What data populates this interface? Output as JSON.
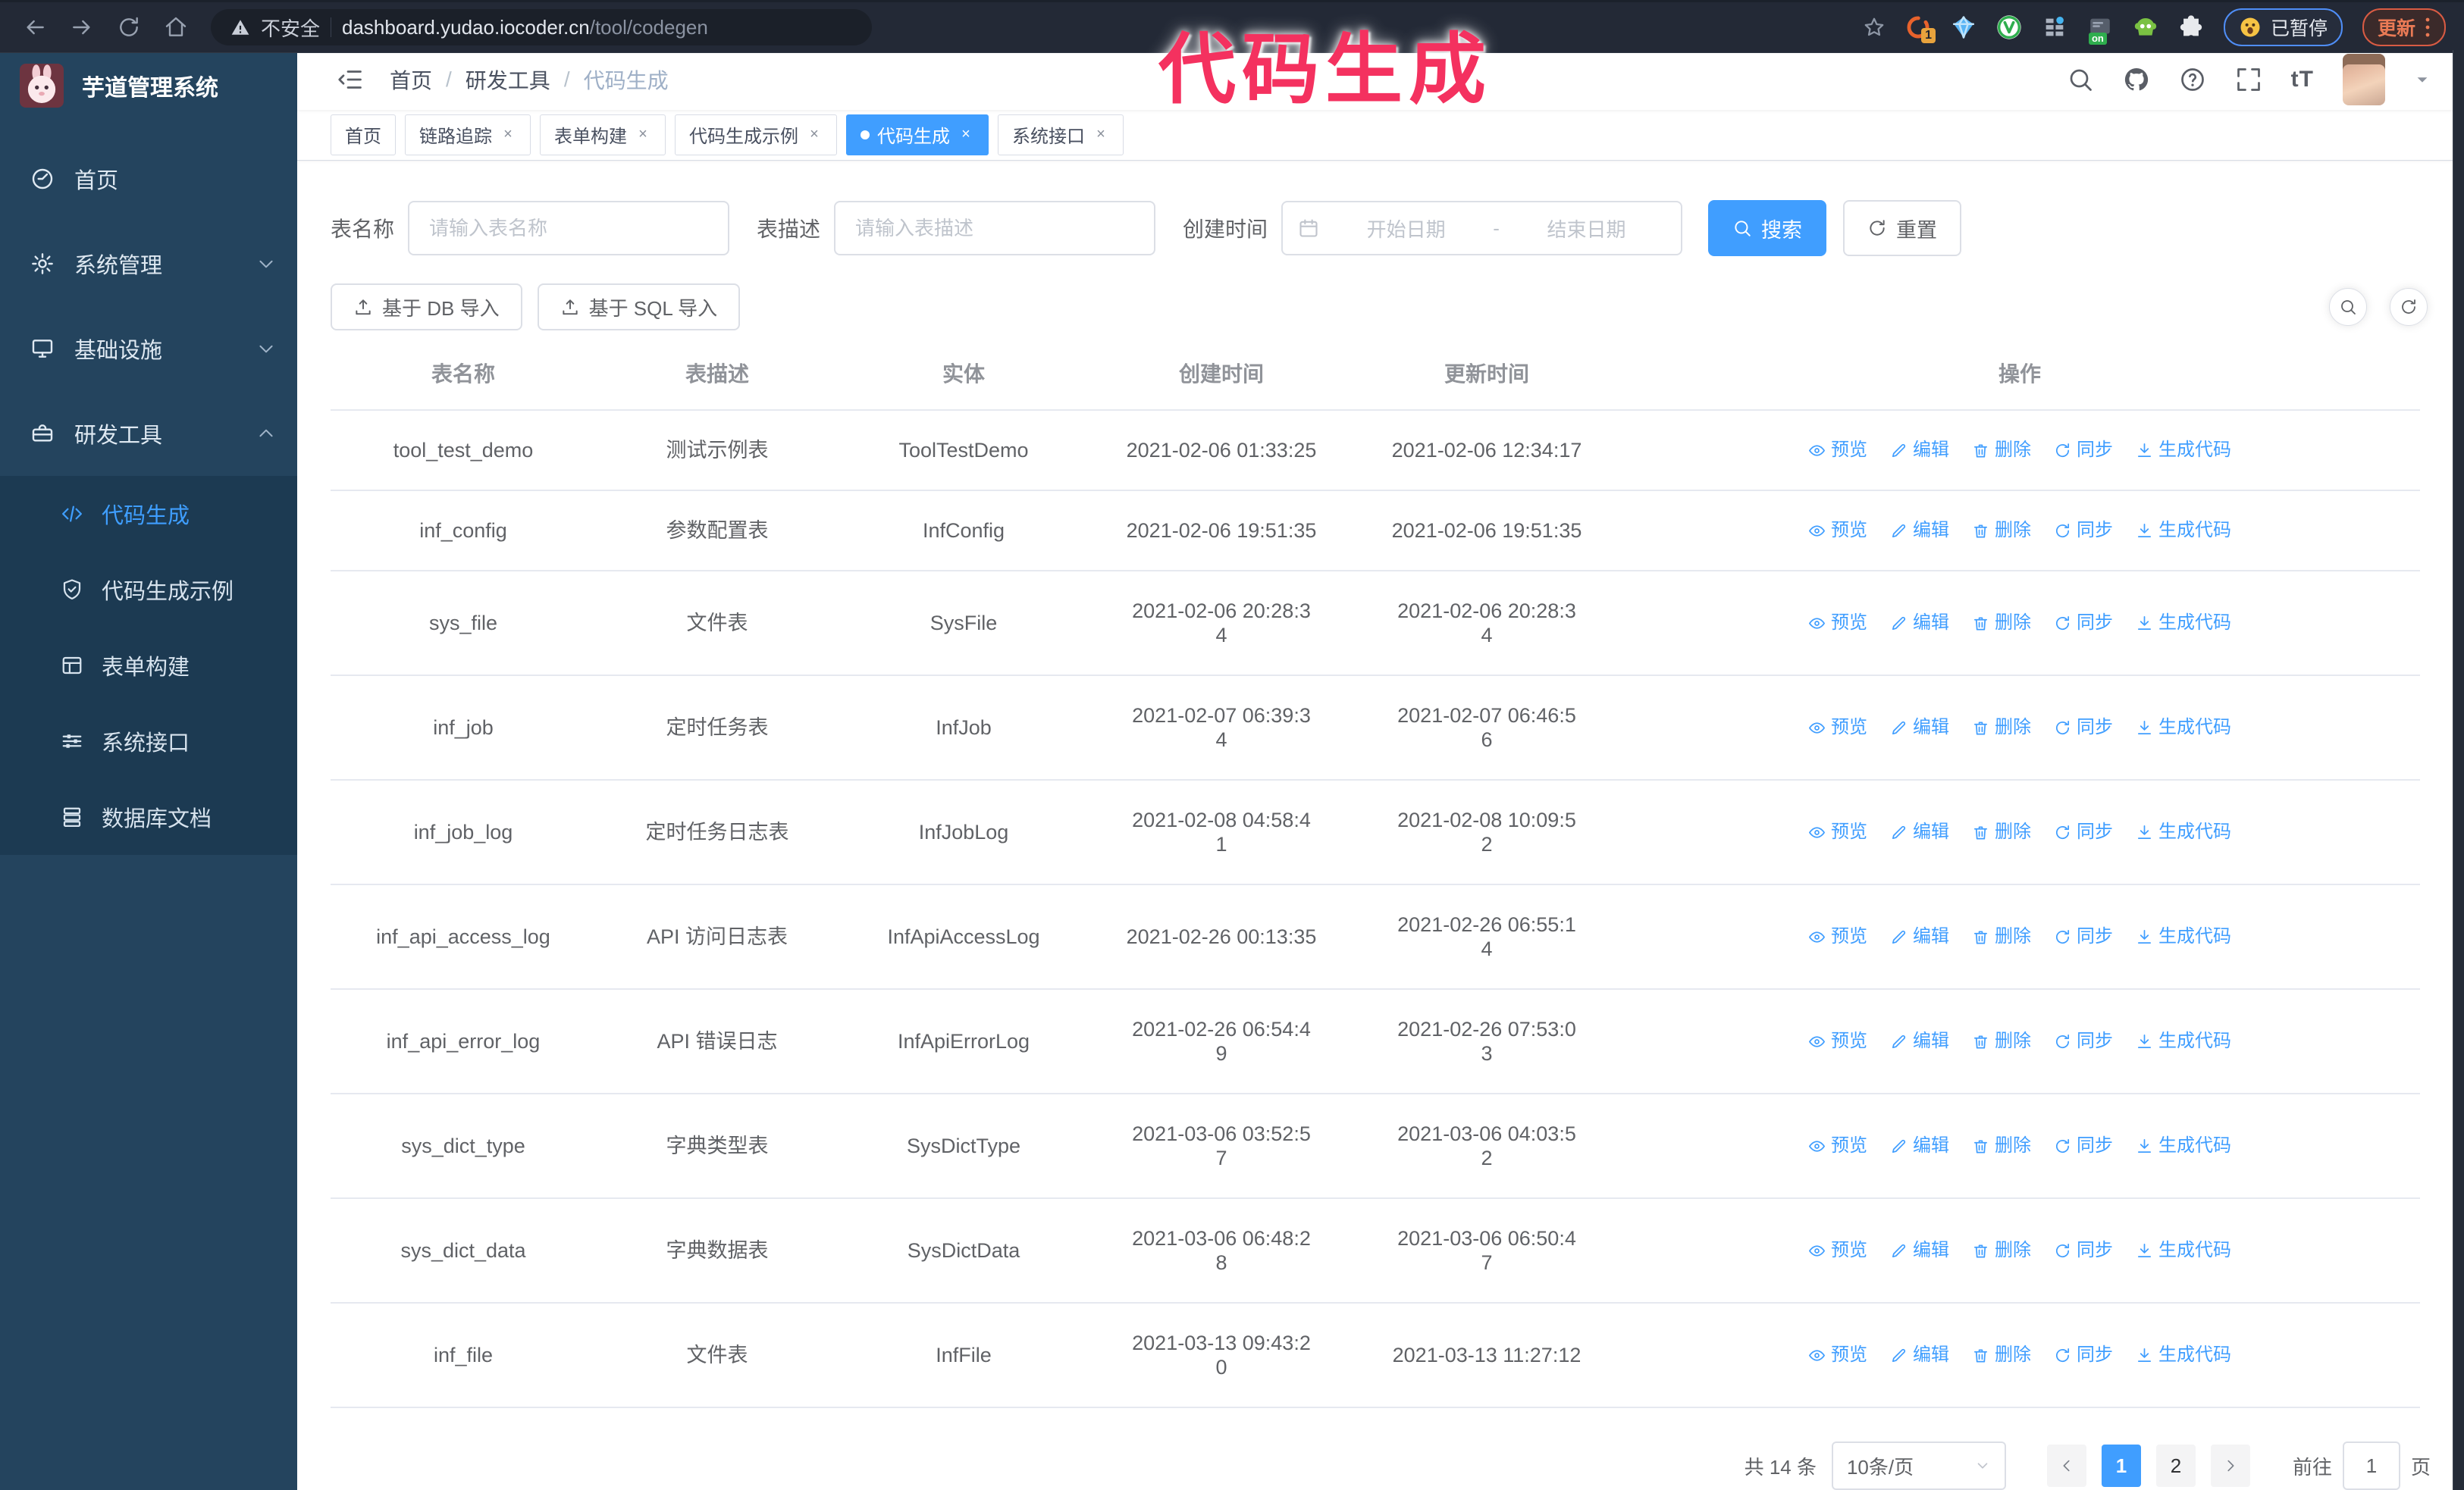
{
  "overlay_title": "代码生成",
  "browser": {
    "security_label": "不安全",
    "url_host": "dashboard.yudao.iocoder.cn",
    "url_path": "/tool/codegen",
    "ext_badge": "1",
    "ext_on_label": "on",
    "paused_label": "已暂停",
    "update_label": "更新"
  },
  "sidebar": {
    "title": "芋道管理系统",
    "items": [
      {
        "label": "首页"
      },
      {
        "label": "系统管理"
      },
      {
        "label": "基础设施"
      },
      {
        "label": "研发工具"
      }
    ],
    "subitems": [
      {
        "label": "代码生成",
        "active": true
      },
      {
        "label": "代码生成示例"
      },
      {
        "label": "表单构建"
      },
      {
        "label": "系统接口"
      },
      {
        "label": "数据库文档"
      }
    ]
  },
  "breadcrumb": {
    "items": [
      "首页",
      "研发工具",
      "代码生成"
    ],
    "separator": "/"
  },
  "tabs": [
    {
      "label": "首页",
      "closable": false,
      "active": false
    },
    {
      "label": "链路追踪",
      "closable": true,
      "active": false
    },
    {
      "label": "表单构建",
      "closable": true,
      "active": false
    },
    {
      "label": "代码生成示例",
      "closable": true,
      "active": false
    },
    {
      "label": "代码生成",
      "closable": true,
      "active": true
    },
    {
      "label": "系统接口",
      "closable": true,
      "active": false
    }
  ],
  "filters": {
    "name_label": "表名称",
    "name_placeholder": "请输入表名称",
    "desc_label": "表描述",
    "desc_placeholder": "请输入表描述",
    "time_label": "创建时间",
    "start_placeholder": "开始日期",
    "range_separator": "-",
    "end_placeholder": "结束日期",
    "search_label": "搜索",
    "reset_label": "重置"
  },
  "toolbar": {
    "db_import_label": "基于 DB 导入",
    "sql_import_label": "基于 SQL 导入"
  },
  "table": {
    "headers": [
      "表名称",
      "表描述",
      "实体",
      "创建时间",
      "更新时间",
      "操作"
    ],
    "actions": [
      "预览",
      "编辑",
      "删除",
      "同步",
      "生成代码"
    ],
    "rows": [
      {
        "name": "tool_test_demo",
        "desc": "测试示例表",
        "entity": "ToolTestDemo",
        "created": "2021-02-06 01:33:25",
        "updated": "2021-02-06 12:34:17"
      },
      {
        "name": "inf_config",
        "desc": "参数配置表",
        "entity": "InfConfig",
        "created": "2021-02-06 19:51:35",
        "updated": "2021-02-06 19:51:35"
      },
      {
        "name": "sys_file",
        "desc": "文件表",
        "entity": "SysFile",
        "created": "2021-02-06 20:28:3\n4",
        "updated": "2021-02-06 20:28:3\n4"
      },
      {
        "name": "inf_job",
        "desc": "定时任务表",
        "entity": "InfJob",
        "created": "2021-02-07 06:39:3\n4",
        "updated": "2021-02-07 06:46:5\n6"
      },
      {
        "name": "inf_job_log",
        "desc": "定时任务日志表",
        "entity": "InfJobLog",
        "created": "2021-02-08 04:58:4\n1",
        "updated": "2021-02-08 10:09:5\n2"
      },
      {
        "name": "inf_api_access_log",
        "desc": "API 访问日志表",
        "entity": "InfApiAccessLog",
        "created": "2021-02-26 00:13:35",
        "updated": "2021-02-26 06:55:1\n4"
      },
      {
        "name": "inf_api_error_log",
        "desc": "API 错误日志",
        "entity": "InfApiErrorLog",
        "created": "2021-02-26 06:54:4\n9",
        "updated": "2021-02-26 07:53:0\n3"
      },
      {
        "name": "sys_dict_type",
        "desc": "字典类型表",
        "entity": "SysDictType",
        "created": "2021-03-06 03:52:5\n7",
        "updated": "2021-03-06 04:03:5\n2"
      },
      {
        "name": "sys_dict_data",
        "desc": "字典数据表",
        "entity": "SysDictData",
        "created": "2021-03-06 06:48:2\n8",
        "updated": "2021-03-06 06:50:4\n7"
      },
      {
        "name": "inf_file",
        "desc": "文件表",
        "entity": "InfFile",
        "created": "2021-03-13 09:43:2\n0",
        "updated": "2021-03-13 11:27:12"
      }
    ]
  },
  "pagination": {
    "total_label": "共 14 条",
    "page_size_label": "10条/页",
    "pages": [
      {
        "label": "1",
        "active": true
      },
      {
        "label": "2",
        "active": false
      }
    ],
    "goto_label": "前往",
    "goto_value": "1",
    "unit_label": "页"
  },
  "colors": {
    "primary": "#409eff",
    "overlay_pink": "#f4315f",
    "sidebar_bg": "#24445e",
    "submenu_bg": "#1c3a52",
    "chrome_bg": "#232936"
  }
}
